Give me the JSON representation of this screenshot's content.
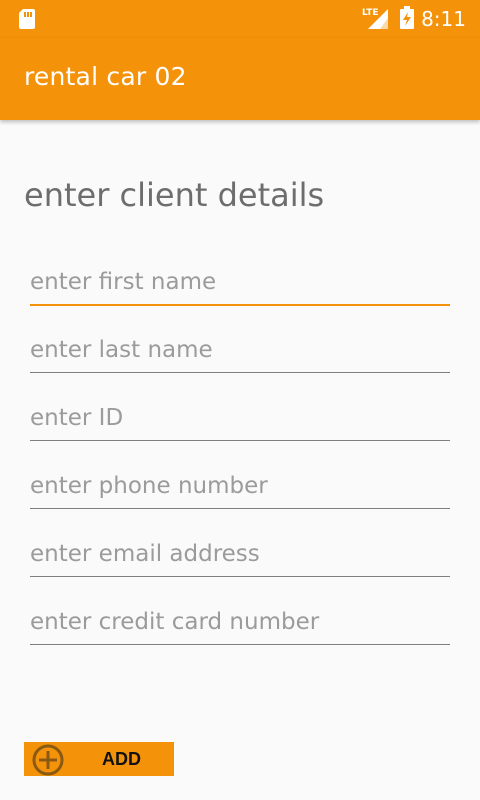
{
  "status_bar": {
    "time": "8:11",
    "network_label": "LTE",
    "icons": [
      "sd-card-icon",
      "signal-icon",
      "battery-charging-icon"
    ]
  },
  "app_bar": {
    "title": "rental car 02",
    "color": "#f4930a"
  },
  "form": {
    "heading": "enter client details",
    "fields": [
      {
        "placeholder": "enter first name",
        "value": ""
      },
      {
        "placeholder": "enter last name",
        "value": ""
      },
      {
        "placeholder": "enter ID",
        "value": ""
      },
      {
        "placeholder": "enter phone number",
        "value": ""
      },
      {
        "placeholder": "enter email address",
        "value": ""
      },
      {
        "placeholder": "enter credit card number",
        "value": ""
      }
    ],
    "add_button": {
      "label": "ADD",
      "icon": "add-circle-icon"
    }
  }
}
